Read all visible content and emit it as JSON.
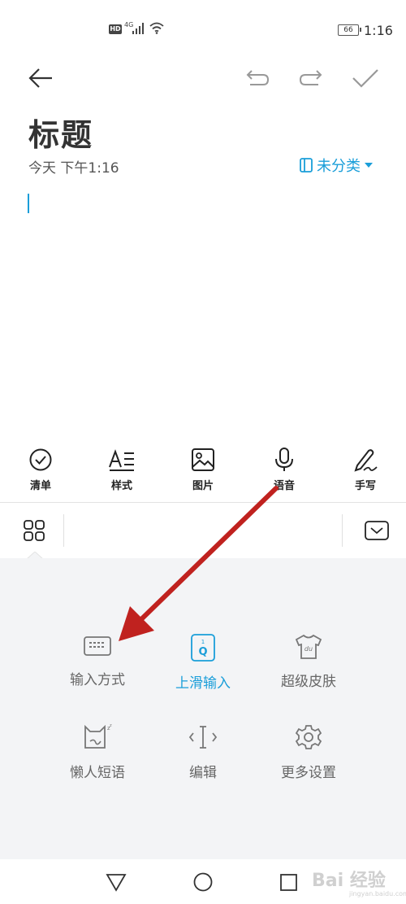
{
  "status_bar": {
    "hd": "HD",
    "network": "4G",
    "battery": "66",
    "time": "1:16"
  },
  "note": {
    "title": "标题",
    "date": "今天 下午1:16",
    "category": "未分类"
  },
  "format_bar": {
    "items": [
      {
        "label": "清单",
        "icon": "checklist-icon"
      },
      {
        "label": "样式",
        "icon": "text-style-icon"
      },
      {
        "label": "图片",
        "icon": "image-icon"
      },
      {
        "label": "语音",
        "icon": "microphone-icon"
      },
      {
        "label": "手写",
        "icon": "handwriting-icon"
      }
    ]
  },
  "keyboard_menu": {
    "items": [
      {
        "label": "输入方式",
        "icon": "keyboard-icon"
      },
      {
        "label": "上滑输入",
        "icon": "swipe-input-icon"
      },
      {
        "label": "超级皮肤",
        "icon": "tshirt-icon"
      },
      {
        "label": "懒人短语",
        "icon": "cat-phrase-icon"
      },
      {
        "label": "编辑",
        "icon": "cursor-edit-icon"
      },
      {
        "label": "更多设置",
        "icon": "gear-icon"
      }
    ],
    "active_index": 1
  },
  "watermark": {
    "text": "Bai 经验",
    "sub": "jingyan.baidu.com"
  },
  "colors": {
    "accent": "#1a9ed9",
    "arrow": "#c0221f",
    "panel_bg": "#f3f4f6"
  }
}
